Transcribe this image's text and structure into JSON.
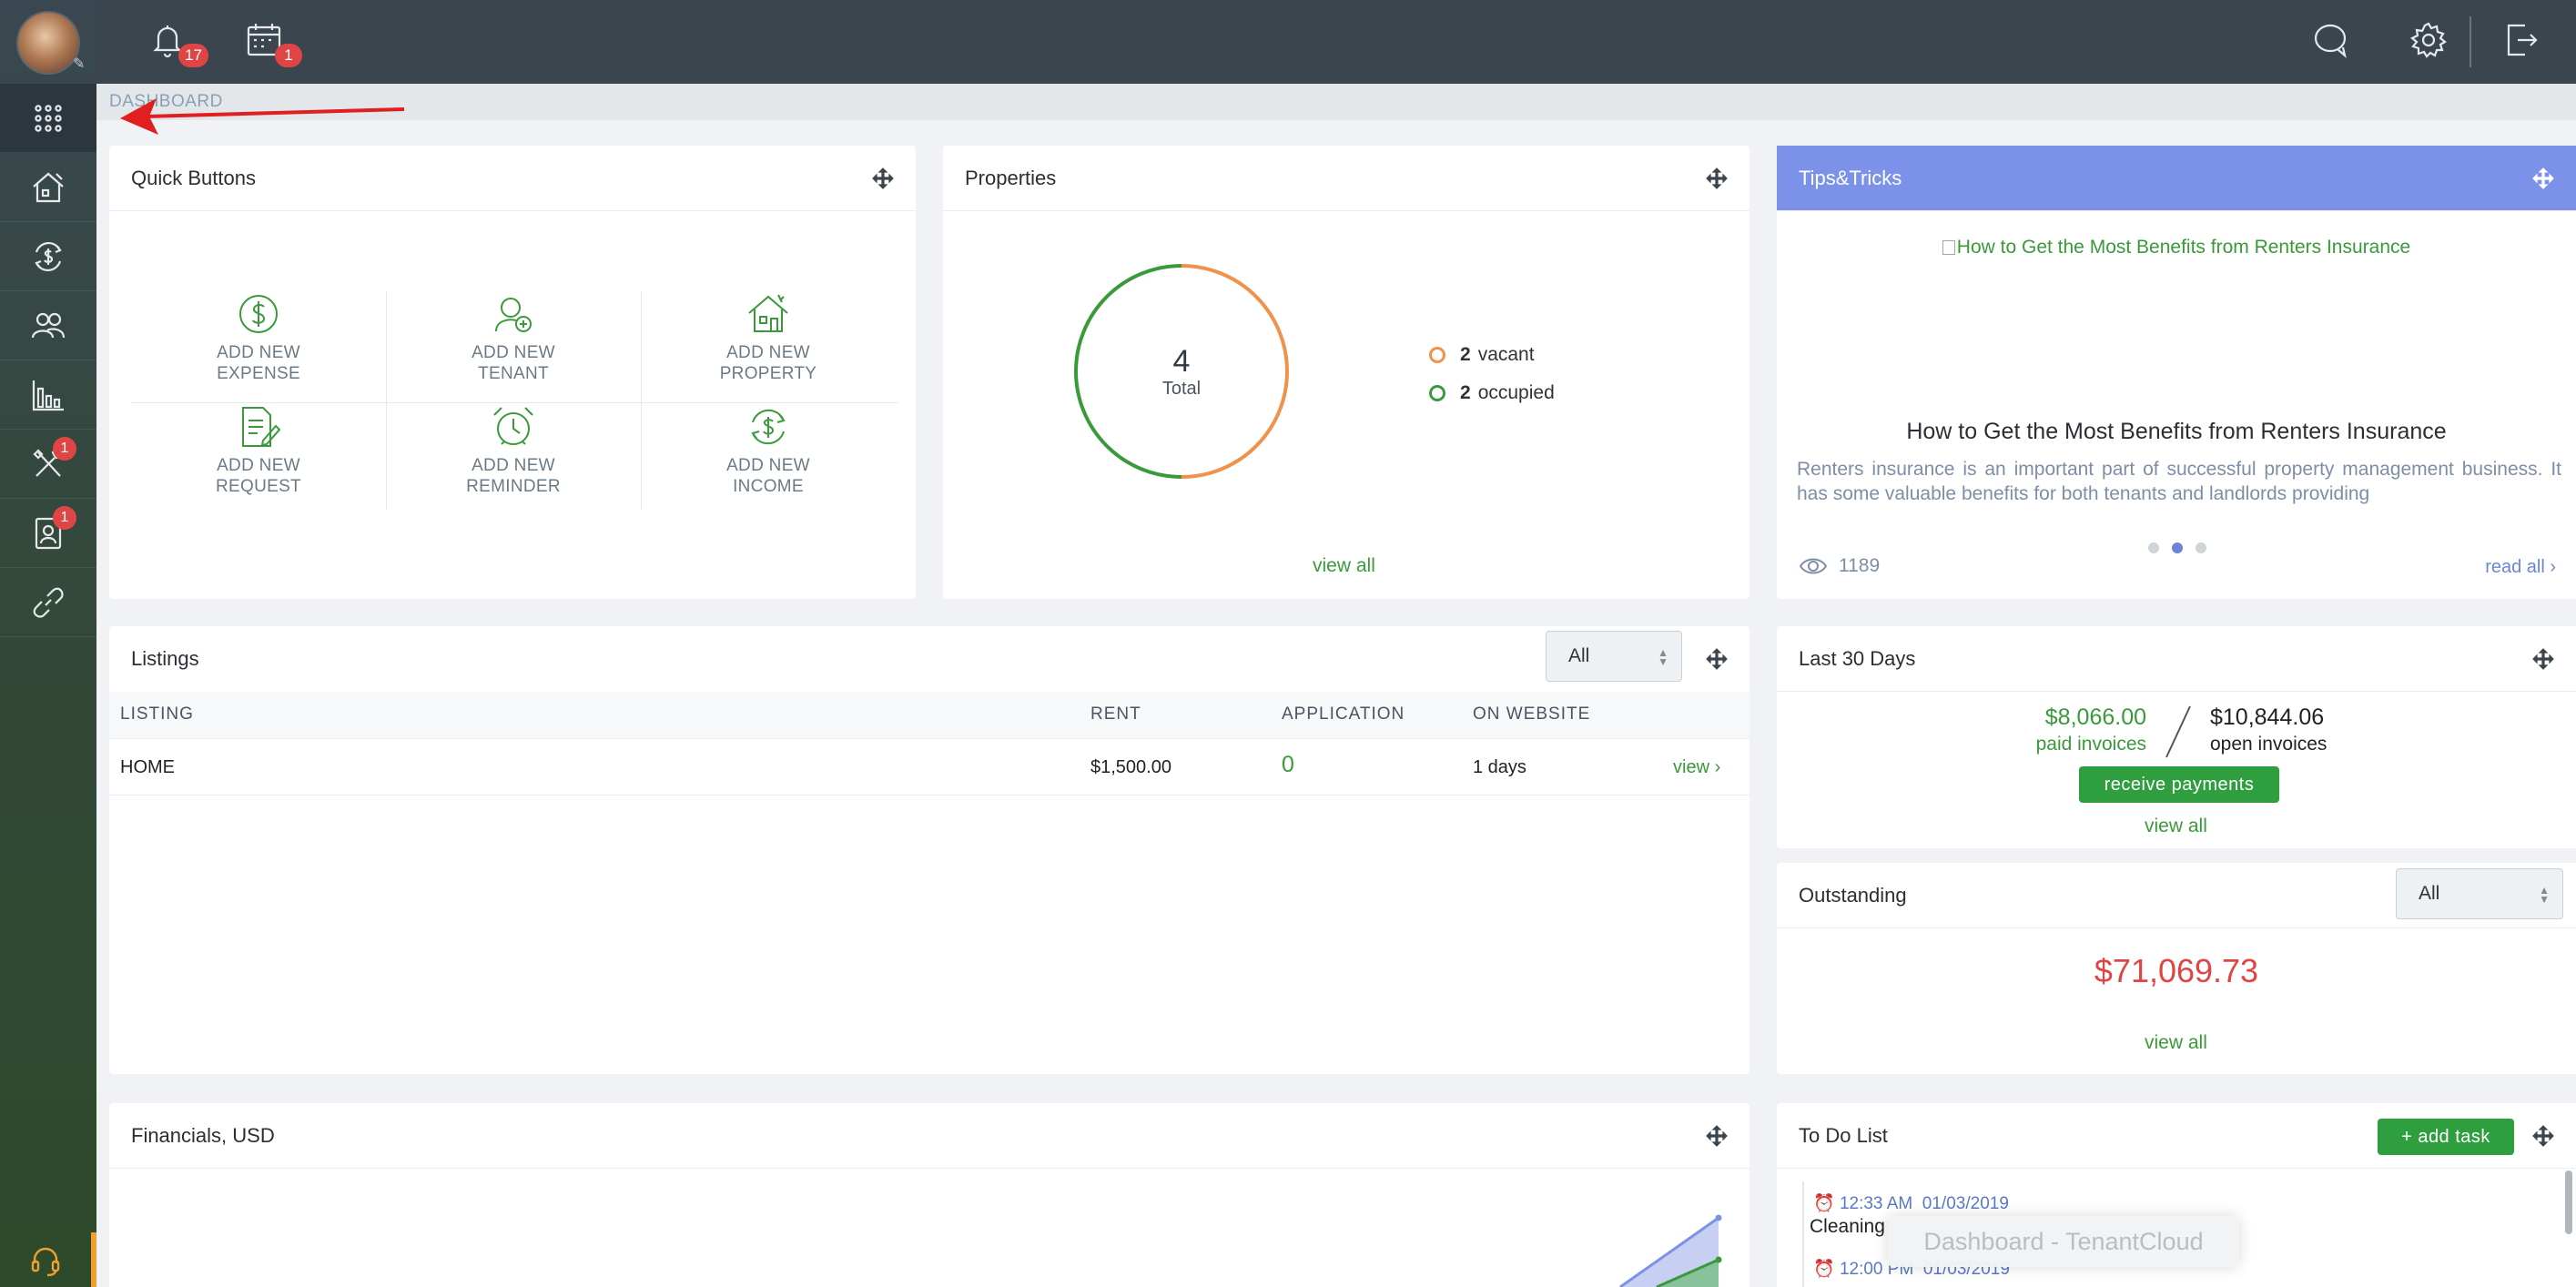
{
  "topbar": {
    "notifications_count": "17",
    "calendar_count": "1"
  },
  "sidebar": {
    "items": [
      {
        "name": "apps",
        "icon": "grid-icon"
      },
      {
        "name": "properties",
        "icon": "house-icon"
      },
      {
        "name": "accounting",
        "icon": "money-cycle-icon"
      },
      {
        "name": "contacts",
        "icon": "people-icon"
      },
      {
        "name": "reports",
        "icon": "bar-chart-icon"
      },
      {
        "name": "maintenance",
        "icon": "tools-icon",
        "badge": "1"
      },
      {
        "name": "applications",
        "icon": "user-card-icon",
        "badge": "1"
      },
      {
        "name": "integrations",
        "icon": "link-icon"
      }
    ]
  },
  "breadcrumb": "DASHBOARD",
  "quick_buttons": {
    "title": "Quick Buttons",
    "items": [
      {
        "line1": "ADD NEW",
        "line2": "EXPENSE"
      },
      {
        "line1": "ADD NEW",
        "line2": "TENANT"
      },
      {
        "line1": "ADD NEW",
        "line2": "PROPERTY"
      },
      {
        "line1": "ADD NEW",
        "line2": "REQUEST"
      },
      {
        "line1": "ADD NEW",
        "line2": "REMINDER"
      },
      {
        "line1": "ADD NEW",
        "line2": "INCOME"
      }
    ]
  },
  "properties": {
    "title": "Properties",
    "total": "4",
    "total_label": "Total",
    "vacant_count": "2",
    "vacant_label": "vacant",
    "occupied_count": "2",
    "occupied_label": "occupied",
    "view_all": "view all",
    "colors": {
      "vacant": "#f0924a",
      "occupied": "#3a9a3a"
    }
  },
  "chart_data": {
    "type": "pie",
    "categories": [
      "vacant",
      "occupied"
    ],
    "values": [
      2,
      2
    ]
  },
  "tips": {
    "title": "Tips&Tricks",
    "image_alt": "How to Get the Most Benefits from Renters Insurance",
    "article_title": "How to Get the Most Benefits from Renters Insurance",
    "article_body": "Renters insurance is an important part of successful property management business. It has some valuable benefits for both tenants and landlords providing",
    "views": "1189",
    "read_all": "read all ›"
  },
  "listings": {
    "title": "Listings",
    "filter": "All",
    "columns": [
      "LISTING",
      "RENT",
      "APPLICATION",
      "ON WEBSITE"
    ],
    "rows": [
      {
        "listing": "HOME",
        "rent": "$1,500.00",
        "application": "0",
        "on_website": "1 days",
        "action": "view ›"
      }
    ]
  },
  "last30": {
    "title": "Last 30 Days",
    "paid_amount": "$8,066.00",
    "paid_label": "paid invoices",
    "open_amount": "$10,844.06",
    "open_label": "open invoices",
    "button": "receive payments",
    "view_all": "view all"
  },
  "outstanding": {
    "title": "Outstanding",
    "filter": "All",
    "amount": "$71,069.73",
    "view_all": "view all"
  },
  "financials": {
    "title": "Financials, USD"
  },
  "todo": {
    "title": "To Do List",
    "add_button": "+ add task",
    "items": [
      {
        "time": "12:33 AM",
        "date": "01/03/2019",
        "text": "Cleaning"
      },
      {
        "time": "12:00 PM",
        "date": "01/03/2019",
        "text": ""
      }
    ]
  },
  "tooltip": "Dashboard - TenantCloud"
}
